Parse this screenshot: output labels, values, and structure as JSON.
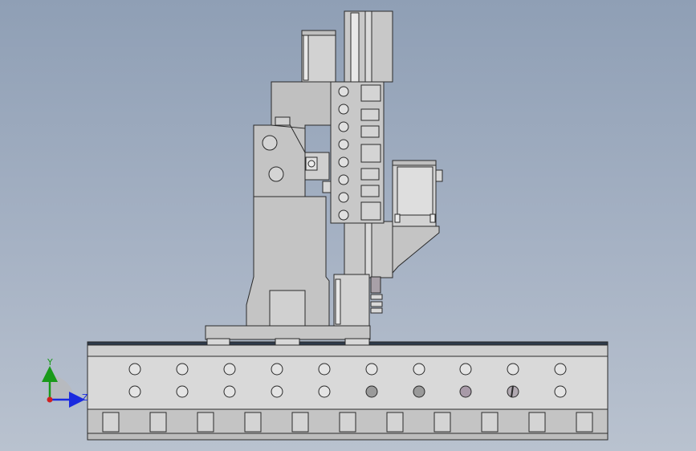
{
  "viewport": {
    "background_top": "#8f9fb5",
    "background_bottom": "#b9c2cf"
  },
  "model": {
    "body_color": "#c8c8c8",
    "edge_color": "#2a2a2a",
    "highlight_color": "#dcdcdc",
    "rail_color": "#2d3a4a"
  },
  "triad": {
    "y_label": "Y",
    "z_label": "Z",
    "y_color": "#1a9a1a",
    "z_color": "#1a2ae0",
    "x_color": "#d02020"
  }
}
